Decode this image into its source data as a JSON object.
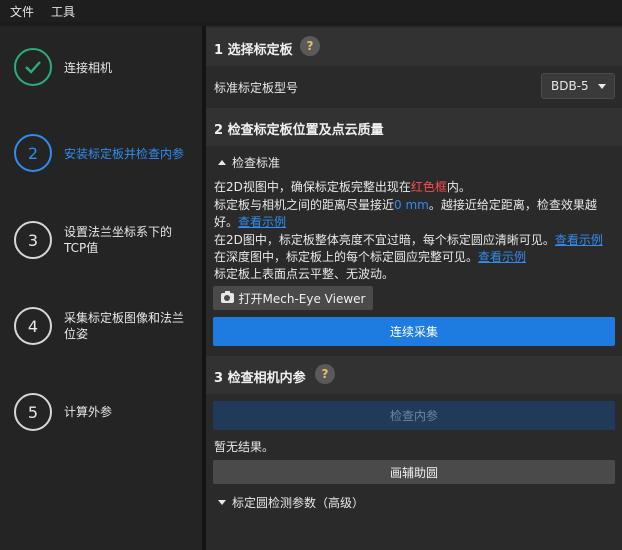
{
  "menubar": {
    "file": "文件",
    "tools": "工具"
  },
  "sidebar": {
    "steps": [
      {
        "number": "✓",
        "label": "连接相机",
        "state": "done"
      },
      {
        "number": "2",
        "label": "安装标定板并检查内参",
        "state": "active"
      },
      {
        "number": "3",
        "label_line1": "设置法兰坐标系下的",
        "label_line2": "TCP值",
        "state": "pending"
      },
      {
        "number": "4",
        "label_line1": "采集标定板图像和法兰",
        "label_line2": "位姿",
        "state": "pending"
      },
      {
        "number": "5",
        "label": "计算外参",
        "state": "pending"
      }
    ]
  },
  "section1": {
    "title": "1 选择标定板",
    "help": "?",
    "board_type_label": "标准标定板型号",
    "board_type_value": "BDB-5"
  },
  "section2": {
    "title": "2 检查标定板位置及点云质量",
    "criteria_toggle": "检查标准",
    "line1_a": "在2D视图中，确保标定板完整出现在",
    "line1_red": "红色框",
    "line1_b": "内。",
    "line2_a": "标定板与相机之间的距离尽量接近",
    "line2_blue": "0 mm",
    "line2_b": "。越接近给定距离，检查效果越",
    "line3_a": "好。",
    "line3_link": "查看示例",
    "line4_a": "在2D图中，标定板整体亮度不宜过暗，每个标定圆应清晰可见。",
    "line4_link": "查看示例",
    "line5_a": "在深度图中，标定板上的每个标定圆应完整可见。",
    "line5_link": "查看示例",
    "line6": "标定板上表面点云平整、无波动。",
    "open_viewer_button": "打开Mech-Eye Viewer",
    "continuous_capture_button": "连续采集"
  },
  "section3": {
    "title": "3 检查相机内参",
    "help": "?",
    "check_button": "检查内参",
    "no_result": "暂无结果。",
    "draw_aid_button": "画辅助圆",
    "params_toggle": "标定圆检测参数（高级）"
  },
  "colors": {
    "accent_blue": "#2f8cf0",
    "done_green": "#27b07a",
    "warning_red": "#ff4d4f"
  }
}
